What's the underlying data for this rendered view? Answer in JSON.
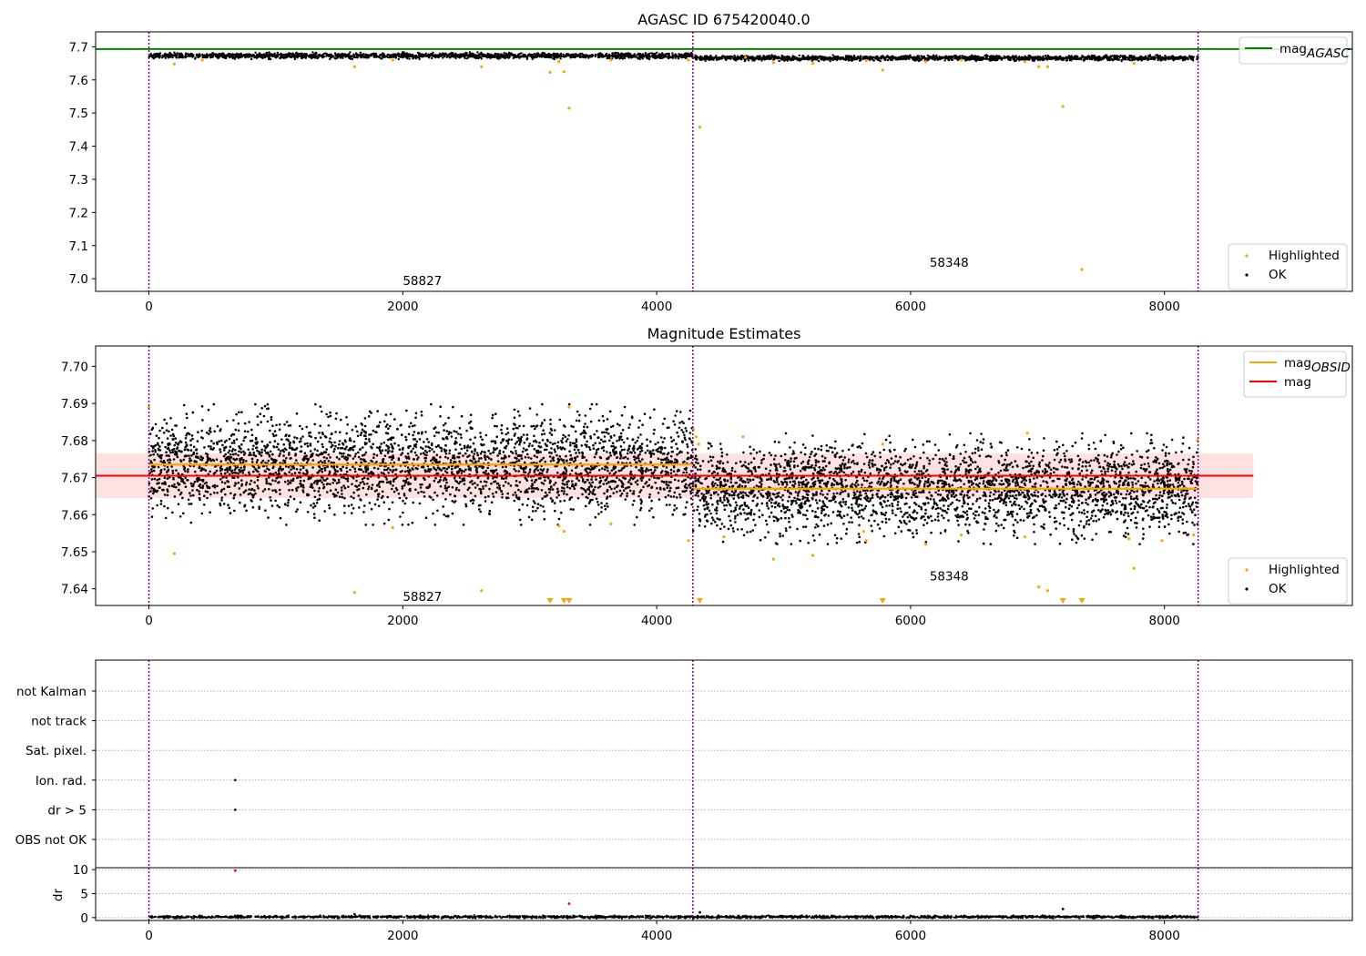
{
  "colors": {
    "ok": "#000000",
    "highlighted": "#ffa500",
    "mag_agasc": "#008000",
    "mag_obsid": "#ffa500",
    "mag": "#ff0000",
    "band": "#ffb3b3",
    "obs_boundary": "#800080",
    "grid": "#b0b0b0",
    "flag_point": "#000000",
    "dr_outlier": "#ff0000"
  },
  "chart_data": [
    {
      "type": "scatter",
      "title": "AGASC ID 675420040.0",
      "xlim": [
        -420,
        9480
      ],
      "ylim": [
        6.962,
        7.745
      ],
      "x_ticks": [
        0,
        2000,
        4000,
        6000,
        8000
      ],
      "y_ticks": [
        7.0,
        7.1,
        7.2,
        7.3,
        7.4,
        7.5,
        7.6,
        7.7
      ],
      "y_tick_labels": [
        "7.0",
        "7.1",
        "7.2",
        "7.3",
        "7.4",
        "7.5",
        "7.6",
        "7.7"
      ],
      "hlines": [
        {
          "name": "mag_AGASC",
          "y": 7.693,
          "color_key": "mag_agasc"
        }
      ],
      "obs_boundaries": [
        0,
        4285,
        8265
      ],
      "obsid_annotations": [
        {
          "text": "58827",
          "x": 2000,
          "y": 6.995
        },
        {
          "text": "58348",
          "x": 6150,
          "y": 7.05
        }
      ],
      "legends": [
        {
          "position": "upper right",
          "entries": [
            {
              "label": "mag",
              "sub": "AGASC",
              "kind": "line",
              "color_key": "mag_agasc"
            }
          ]
        },
        {
          "position": "lower right",
          "entries": [
            {
              "label": "Highlighted",
              "kind": "dot",
              "color_key": "highlighted"
            },
            {
              "label": "OK",
              "kind": "dot",
              "color_key": "ok"
            }
          ]
        }
      ],
      "series": [
        {
          "name": "OK",
          "kind": "dense-band",
          "segments": [
            {
              "x": [
                0,
                4285
              ],
              "center": 7.673,
              "half_width": 0.008
            },
            {
              "x": [
                4285,
                8265
              ],
              "center": 7.666,
              "half_width": 0.007
            }
          ]
        },
        {
          "name": "Highlighted",
          "points": [
            [
              200,
              7.648
            ],
            [
              420,
              7.66
            ],
            [
              1620,
              7.64
            ],
            [
              1920,
              7.66
            ],
            [
              2620,
              7.64
            ],
            [
              3160,
              7.623
            ],
            [
              3230,
              7.655
            ],
            [
              3270,
              7.625
            ],
            [
              3310,
              7.515
            ],
            [
              3640,
              7.66
            ],
            [
              4250,
              7.66
            ],
            [
              4340,
              7.458
            ],
            [
              4700,
              7.668
            ],
            [
              4920,
              7.652
            ],
            [
              5230,
              7.65
            ],
            [
              5650,
              7.658
            ],
            [
              5780,
              7.63
            ],
            [
              6120,
              7.655
            ],
            [
              6400,
              7.66
            ],
            [
              6900,
              7.655
            ],
            [
              7010,
              7.64
            ],
            [
              7080,
              7.64
            ],
            [
              7200,
              7.52
            ],
            [
              7350,
              7.028
            ],
            [
              7760,
              7.65
            ]
          ]
        }
      ]
    },
    {
      "type": "scatter",
      "title": "Magnitude Estimates",
      "xlim": [
        -420,
        9480
      ],
      "ylim": [
        7.6355,
        7.7055
      ],
      "x_ticks": [
        0,
        2000,
        4000,
        6000,
        8000
      ],
      "y_ticks": [
        7.64,
        7.65,
        7.66,
        7.67,
        7.68,
        7.69,
        7.7
      ],
      "y_tick_labels": [
        "7.64",
        "7.65",
        "7.66",
        "7.67",
        "7.68",
        "7.69",
        "7.70"
      ],
      "hlines": [
        {
          "name": "mag_OBSID",
          "segments": [
            {
              "x": [
                0,
                4285
              ],
              "y": 7.6735
            },
            {
              "x": [
                4285,
                8265
              ],
              "y": 7.667
            }
          ],
          "color_key": "mag_obsid"
        },
        {
          "name": "mag",
          "y": 7.6705,
          "color_key": "mag"
        }
      ],
      "mag_band": {
        "x": [
          -420,
          8700
        ],
        "y": [
          7.6645,
          7.6765
        ]
      },
      "obs_boundaries": [
        0,
        4285,
        8265
      ],
      "obsid_annotations": [
        {
          "text": "58827",
          "x": 2000,
          "y": 7.638
        },
        {
          "text": "58348",
          "x": 6150,
          "y": 7.6435
        }
      ],
      "legends": [
        {
          "position": "upper right",
          "entries": [
            {
              "label": "mag",
              "sub": "OBSID",
              "kind": "line",
              "color_key": "mag_obsid"
            },
            {
              "label": "mag",
              "kind": "line",
              "color_key": "mag"
            }
          ]
        },
        {
          "position": "lower right",
          "entries": [
            {
              "label": "Highlighted",
              "kind": "dot",
              "color_key": "highlighted"
            },
            {
              "label": "OK",
              "kind": "dot",
              "color_key": "ok"
            }
          ]
        }
      ],
      "series": [
        {
          "name": "OK",
          "kind": "dense-band",
          "segments": [
            {
              "x": [
                0,
                4285
              ],
              "center": 7.6735,
              "half_width": 0.0125
            },
            {
              "x": [
                4285,
                8265
              ],
              "center": 7.667,
              "half_width": 0.0115
            }
          ]
        },
        {
          "name": "Highlighted",
          "points": [
            [
              0,
              7.689
            ],
            [
              200,
              7.6495
            ],
            [
              1620,
              7.639
            ],
            [
              1920,
              7.6565
            ],
            [
              2620,
              7.6395
            ],
            [
              3230,
              7.657
            ],
            [
              3270,
              7.6555
            ],
            [
              3310,
              7.689
            ],
            [
              3640,
              7.6575
            ],
            [
              4250,
              7.653
            ],
            [
              4290,
              7.683
            ],
            [
              4310,
              7.681
            ],
            [
              4330,
              7.679
            ],
            [
              4530,
              7.654
            ],
            [
              4680,
              7.681
            ],
            [
              4920,
              7.648
            ],
            [
              5230,
              7.649
            ],
            [
              5630,
              7.6555
            ],
            [
              5650,
              7.653
            ],
            [
              5780,
              7.679
            ],
            [
              6120,
              7.652
            ],
            [
              6400,
              7.6545
            ],
            [
              6900,
              7.654
            ],
            [
              6920,
              7.682
            ],
            [
              7010,
              7.6405
            ],
            [
              7080,
              7.6395
            ],
            [
              7720,
              7.6535
            ],
            [
              7760,
              7.6455
            ],
            [
              7980,
              7.653
            ],
            [
              8230,
              7.6545
            ],
            [
              8260,
              7.68
            ]
          ]
        },
        {
          "name": "Highlighted (below axis)",
          "marker": "down-triangle",
          "x": [
            3160,
            3270,
            3310,
            4340,
            5780,
            7200,
            7350
          ]
        }
      ]
    },
    {
      "type": "scatter",
      "title": "",
      "xlim": [
        -420,
        9480
      ],
      "categories": [
        "not Kalman",
        "not track",
        "Sat. pixel.",
        "Ion. rad.",
        "dr > 5",
        "OBS not OK"
      ],
      "obs_boundaries": [
        0,
        4285,
        8265
      ],
      "series": [
        {
          "name": "flags",
          "points": [
            [
              680,
              "Ion. rad."
            ],
            [
              680,
              "dr > 5"
            ]
          ]
        }
      ]
    },
    {
      "type": "scatter",
      "title": "",
      "ylabel": "dr",
      "xlim": [
        -420,
        9480
      ],
      "ylim": [
        -0.6,
        10.4
      ],
      "x_ticks": [
        0,
        2000,
        4000,
        6000,
        8000
      ],
      "y_ticks": [
        0,
        5,
        10
      ],
      "y_tick_labels": [
        "0",
        "5",
        "10"
      ],
      "obs_boundaries": [
        0,
        4285,
        8265
      ],
      "series": [
        {
          "name": "dr",
          "kind": "dense-band",
          "segments": [
            {
              "x": [
                0,
                8265
              ],
              "center": 0.15,
              "half_width": 0.25
            }
          ]
        },
        {
          "name": "dr > 5",
          "points": [
            [
              680,
              9.8
            ],
            [
              3310,
              2.9
            ],
            [
              7200,
              1.8
            ],
            [
              4340,
              1.1
            ],
            [
              1620,
              0.7
            ]
          ]
        }
      ]
    }
  ]
}
